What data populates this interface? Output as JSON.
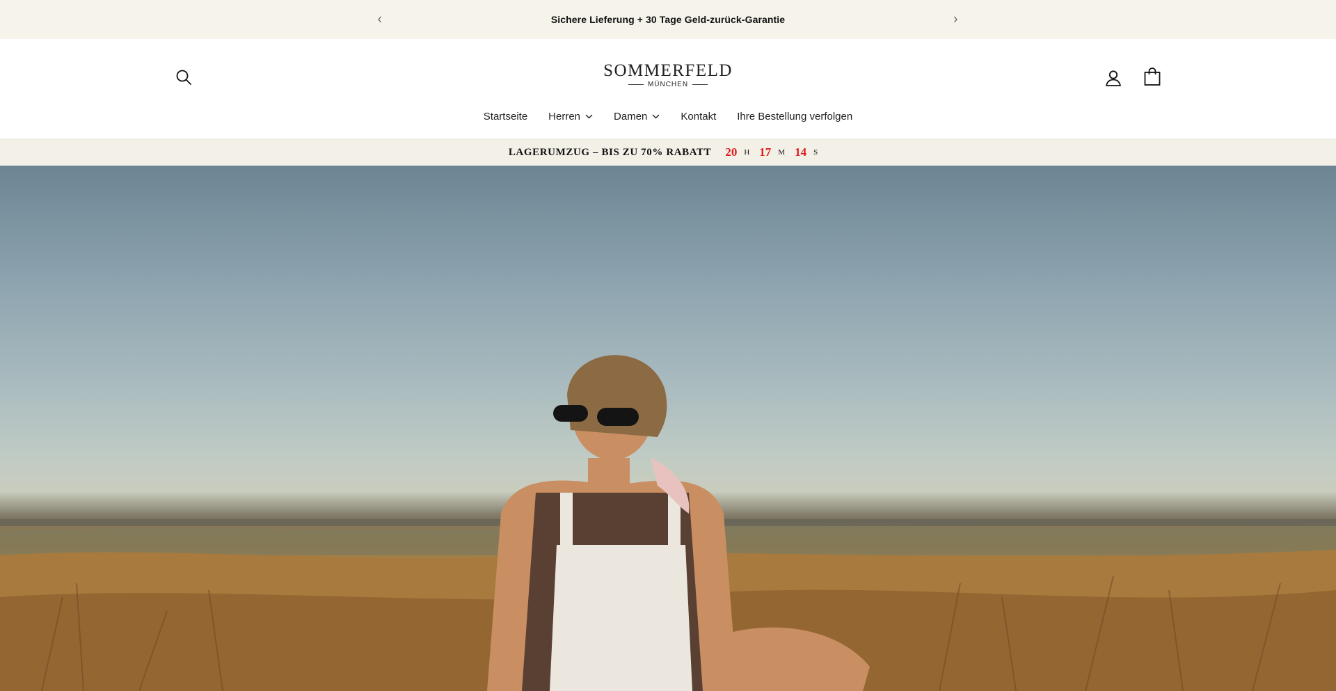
{
  "announcement": {
    "text": "Sichere Lieferung + 30 Tage Geld-zurück-Garantie",
    "prev_icon": "chevron-left-icon",
    "next_icon": "chevron-right-icon"
  },
  "header": {
    "logo": {
      "main": "SOMMERFELD",
      "sub": "MÜNCHEN"
    },
    "icons": {
      "search": "search-icon",
      "account": "user-icon",
      "cart": "shopping-bag-icon"
    },
    "nav": [
      {
        "label": "Startseite",
        "has_dropdown": false
      },
      {
        "label": "Herren",
        "has_dropdown": true
      },
      {
        "label": "Damen",
        "has_dropdown": true
      },
      {
        "label": "Kontakt",
        "has_dropdown": false
      },
      {
        "label": "Ihre Bestellung verfolgen",
        "has_dropdown": false
      }
    ]
  },
  "promo": {
    "text": "LAGERUMZUG – BIS ZU 70% RABATT",
    "countdown": {
      "hours": "20",
      "hours_unit": "H",
      "minutes": "17",
      "minutes_unit": "M",
      "seconds": "14",
      "seconds_unit": "S"
    }
  },
  "colors": {
    "announcement_bg": "#f6f3ea",
    "promo_bg": "#f3f0e8",
    "countdown_accent": "#e01b1b"
  }
}
